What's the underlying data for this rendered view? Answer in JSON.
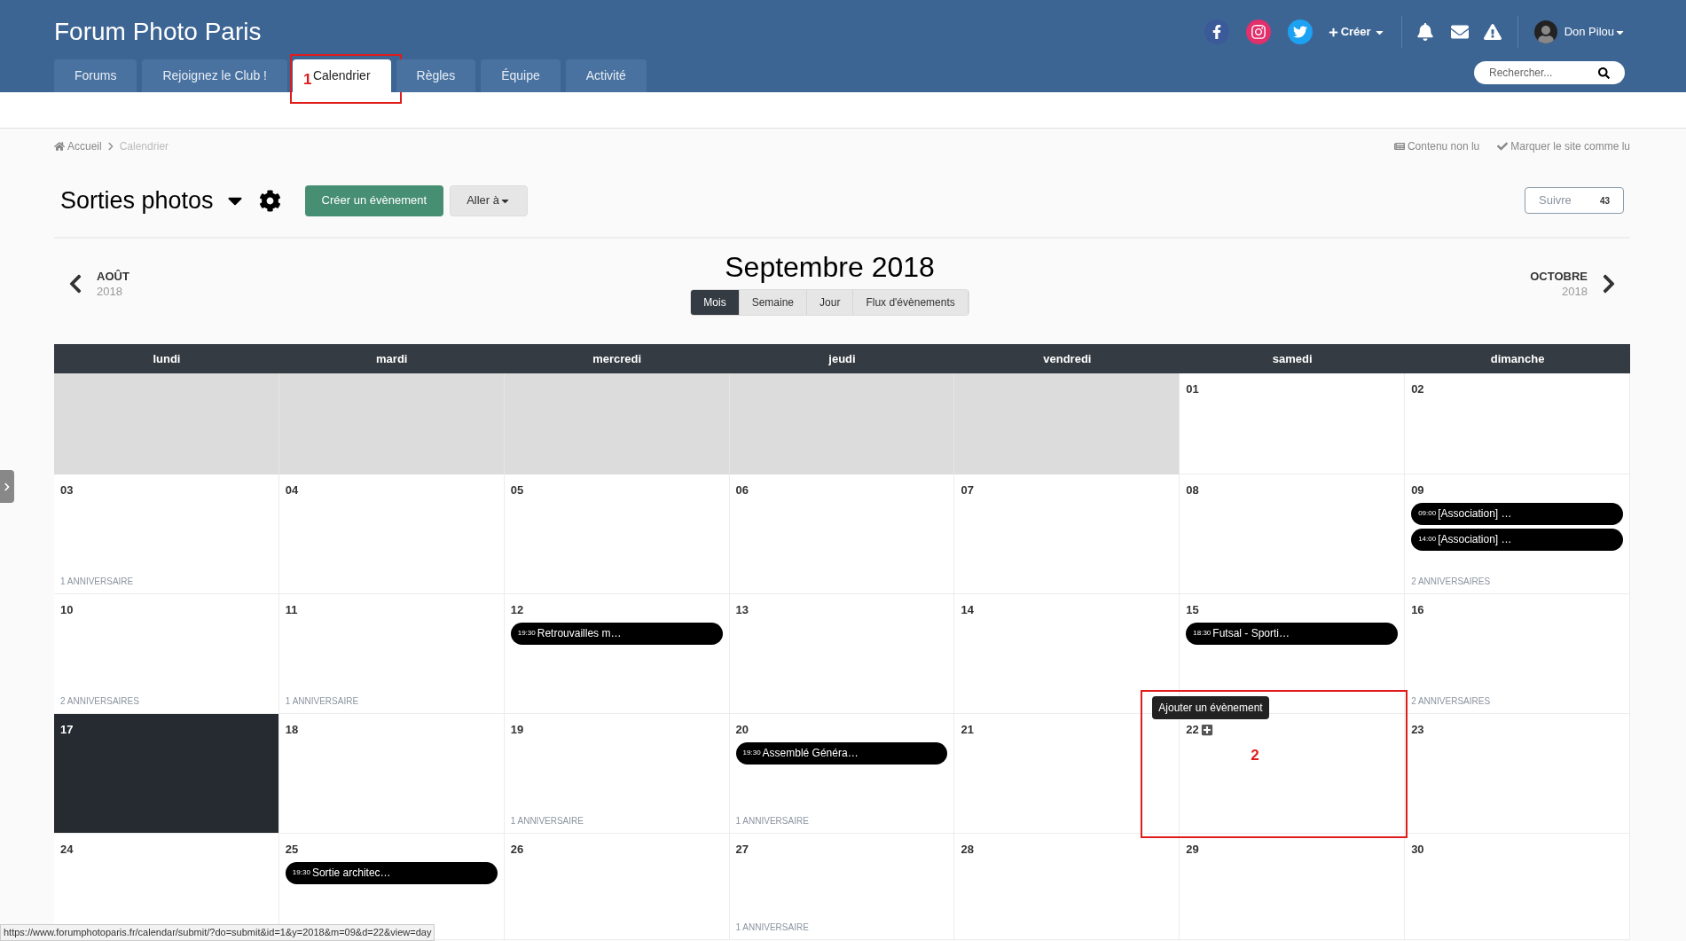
{
  "site": {
    "title": "Forum Photo Paris"
  },
  "nav_tabs": [
    {
      "label": "Forums",
      "selected": false
    },
    {
      "label": "Rejoignez le Club !",
      "selected": false
    },
    {
      "label": "Calendrier",
      "selected": true
    },
    {
      "label": "Règles",
      "selected": false
    },
    {
      "label": "Équipe",
      "selected": false
    },
    {
      "label": "Activité",
      "selected": false
    }
  ],
  "header_actions": {
    "create": "Créer",
    "user": "Don Pilou"
  },
  "search": {
    "placeholder": "Rechercher..."
  },
  "breadcrumb": [
    "Accueil",
    "Calendrier"
  ],
  "top_links": [
    {
      "kind": "unread",
      "label": "Contenu non lu"
    },
    {
      "kind": "mark",
      "label": "Marquer le site comme lu"
    }
  ],
  "calendar_title": "Sorties photos",
  "buttons": {
    "create_event": "Créer un évènement",
    "go_to": "Aller à"
  },
  "follow": {
    "label": "Suivre",
    "count": "43"
  },
  "month": {
    "title": "Septembre 2018",
    "prev": {
      "month": "AOÛT",
      "year": "2018"
    },
    "next": {
      "month": "OCTOBRE",
      "year": "2018"
    }
  },
  "views": [
    {
      "label": "Mois",
      "selected": true
    },
    {
      "label": "Semaine",
      "selected": false
    },
    {
      "label": "Jour",
      "selected": false
    },
    {
      "label": "Flux d'évènements",
      "selected": false
    }
  ],
  "weekdays": [
    "lundi",
    "mardi",
    "mercredi",
    "jeudi",
    "vendredi",
    "samedi",
    "dimanche"
  ],
  "weeks": [
    [
      {
        "kind": "blank"
      },
      {
        "kind": "blank"
      },
      {
        "kind": "blank"
      },
      {
        "kind": "blank"
      },
      {
        "kind": "blank"
      },
      {
        "kind": "day",
        "date": "01",
        "selected": false,
        "hovered": false
      },
      {
        "kind": "day",
        "date": "02",
        "selected": false,
        "hovered": false
      }
    ],
    [
      {
        "kind": "day",
        "date": "03",
        "selected": false,
        "hovered": false,
        "footer": "1 ANNIVERSAIRE"
      },
      {
        "kind": "day",
        "date": "04",
        "selected": false,
        "hovered": false
      },
      {
        "kind": "day",
        "date": "05",
        "selected": false,
        "hovered": false
      },
      {
        "kind": "day",
        "date": "06",
        "selected": false,
        "hovered": false
      },
      {
        "kind": "day",
        "date": "07",
        "selected": false,
        "hovered": false
      },
      {
        "kind": "day",
        "date": "08",
        "selected": false,
        "hovered": false
      },
      {
        "kind": "day",
        "date": "09",
        "selected": false,
        "hovered": false,
        "events": [
          {
            "time": "09:00",
            "title": "[Association] …"
          },
          {
            "time": "14:00",
            "title": "[Association] …"
          }
        ],
        "footer": "2 ANNIVERSAIRES"
      }
    ],
    [
      {
        "kind": "day",
        "date": "10",
        "selected": false,
        "hovered": false,
        "footer": "2 ANNIVERSAIRES"
      },
      {
        "kind": "day",
        "date": "11",
        "selected": false,
        "hovered": false,
        "footer": "1 ANNIVERSAIRE"
      },
      {
        "kind": "day",
        "date": "12",
        "selected": false,
        "hovered": false,
        "events": [
          {
            "time": "19:30",
            "title": "Retrouvailles m…"
          }
        ]
      },
      {
        "kind": "day",
        "date": "13",
        "selected": false,
        "hovered": false
      },
      {
        "kind": "day",
        "date": "14",
        "selected": false,
        "hovered": false
      },
      {
        "kind": "day",
        "date": "15",
        "selected": false,
        "hovered": false,
        "events": [
          {
            "time": "18:30",
            "title": "Futsal - Sporti…"
          }
        ]
      },
      {
        "kind": "day",
        "date": "16",
        "selected": false,
        "hovered": false,
        "footer": "2 ANNIVERSAIRES"
      }
    ],
    [
      {
        "kind": "day",
        "date": "17",
        "selected": true,
        "hovered": false
      },
      {
        "kind": "day",
        "date": "18",
        "selected": false,
        "hovered": false
      },
      {
        "kind": "day",
        "date": "19",
        "selected": false,
        "hovered": false,
        "footer": "1 ANNIVERSAIRE"
      },
      {
        "kind": "day",
        "date": "20",
        "selected": false,
        "hovered": false,
        "events": [
          {
            "time": "19:30",
            "title": "Assemblé Généra…"
          }
        ],
        "footer": "1 ANNIVERSAIRE"
      },
      {
        "kind": "day",
        "date": "21",
        "selected": false,
        "hovered": false
      },
      {
        "kind": "day",
        "date": "22",
        "selected": false,
        "hovered": true
      },
      {
        "kind": "day",
        "date": "23",
        "selected": false,
        "hovered": false
      }
    ],
    [
      {
        "kind": "day",
        "date": "24",
        "selected": false,
        "hovered": false
      },
      {
        "kind": "day",
        "date": "25",
        "selected": false,
        "hovered": false,
        "events": [
          {
            "time": "19:30",
            "title": "Sortie architec…"
          }
        ]
      },
      {
        "kind": "day",
        "date": "26",
        "selected": false,
        "hovered": false
      },
      {
        "kind": "day",
        "date": "27",
        "selected": false,
        "hovered": false,
        "footer": "1 ANNIVERSAIRE"
      },
      {
        "kind": "day",
        "date": "28",
        "selected": false,
        "hovered": false
      },
      {
        "kind": "day",
        "date": "29",
        "selected": false,
        "hovered": false
      },
      {
        "kind": "day",
        "date": "30",
        "selected": false,
        "hovered": false
      }
    ]
  ],
  "tooltip": "Ajouter un évènement",
  "annotations": [
    "1",
    "2"
  ],
  "status_url": "https://www.forumphotoparis.fr/calendar/submit/?do=submit&id=1&y=2018&m=09&d=22&view=day"
}
